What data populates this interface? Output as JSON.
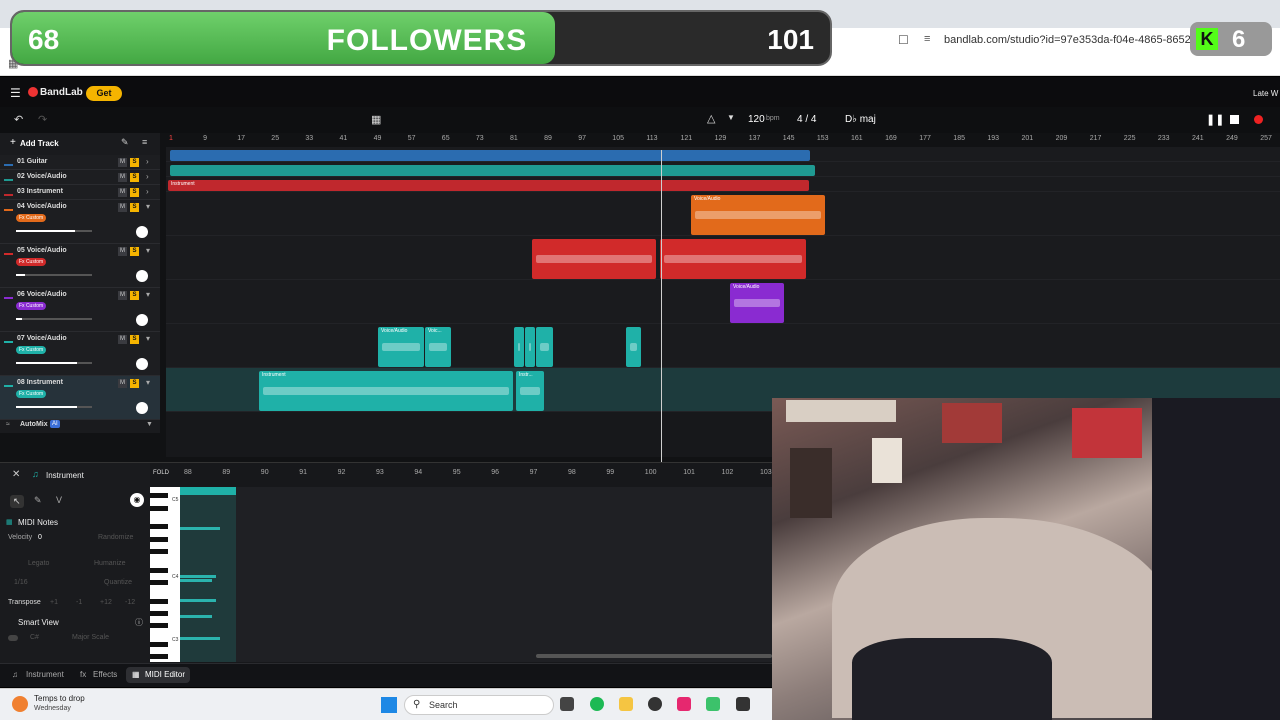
{
  "browser": {
    "url": "bandlab.com/studio?id=97e353da-f04e-4865-8652-e51420b"
  },
  "overlay": {
    "followers_current": "68",
    "followers_label": "FOLLOWERS",
    "followers_goal": "101",
    "kick_viewers": "6",
    "progress_fraction": 0.66
  },
  "app": {
    "brand": "BandLab",
    "get_label": "Get",
    "tempo": "120",
    "tempo_unit": "bpm",
    "time_signature": "4 / 4",
    "key": "D♭ maj",
    "right_cut_text": "Late W",
    "add_track_label": "Add Track",
    "automix_label": "AutoMix",
    "automix_badge": "AI"
  },
  "tracks": [
    {
      "num": "01",
      "name": "Guitar",
      "color": "#2b6cb0"
    },
    {
      "num": "02",
      "name": "Voice/Audio",
      "color": "#1f9a92"
    },
    {
      "num": "03",
      "name": "Instrument",
      "color": "#c0282d"
    },
    {
      "num": "04",
      "name": "Voice/Audio",
      "fx": "Fx Custom",
      "color": "#e26a1b"
    },
    {
      "num": "05",
      "name": "Voice/Audio",
      "fx": "Fx Custom",
      "color": "#d12a2a"
    },
    {
      "num": "06",
      "name": "Voice/Audio",
      "fx": "Fx Custom",
      "color": "#8a2bd1"
    },
    {
      "num": "07",
      "name": "Voice/Audio",
      "fx": "Fx Custom",
      "color": "#1fb1a8"
    },
    {
      "num": "08",
      "name": "Instrument",
      "fx": "Fx Custom",
      "color": "#1fb1a8"
    }
  ],
  "track_buttons": {
    "mute": "M",
    "solo": "S"
  },
  "ruler": [
    "1",
    "9",
    "17",
    "25",
    "33",
    "41",
    "49",
    "57",
    "65",
    "73",
    "81",
    "89",
    "97",
    "105",
    "113",
    "121",
    "129",
    "137",
    "145",
    "153",
    "161",
    "169",
    "177",
    "185",
    "193",
    "201",
    "209",
    "217",
    "225",
    "233",
    "241",
    "249",
    "257"
  ],
  "clip_labels": {
    "instrument": "Instrument",
    "voice_audio": "Voice/Audio",
    "voic": "Voic...",
    "instr": "Instr..."
  },
  "midi": {
    "title": "Instrument",
    "fold_label": "FOLD",
    "ruler": [
      "88",
      "89",
      "90",
      "91",
      "92",
      "93",
      "94",
      "95",
      "96",
      "97",
      "98",
      "99",
      "100",
      "101",
      "102",
      "103"
    ],
    "midi_notes_label": "MIDI Notes",
    "velocity_label": "Velocity",
    "velocity_value": "0",
    "randomize_label": "Randomize",
    "legato_label": "Legato",
    "humanize_label": "Humanize",
    "grid_value": "1/16",
    "quantize_label": "Quantize",
    "transpose_label": "Transpose",
    "transpose_options": [
      "+1",
      "-1",
      "+12",
      "-12"
    ],
    "smart_view_label": "Smart View",
    "key_value": "C#",
    "scale_value": "Major Scale",
    "key_labels": [
      "C5",
      "C4",
      "C3"
    ]
  },
  "bottom_tabs": [
    "Instrument",
    "Effects",
    "MIDI Editor"
  ],
  "taskbar": {
    "weather_line1": "Temps to drop",
    "weather_line2": "Wednesday",
    "search_label": "Search"
  }
}
